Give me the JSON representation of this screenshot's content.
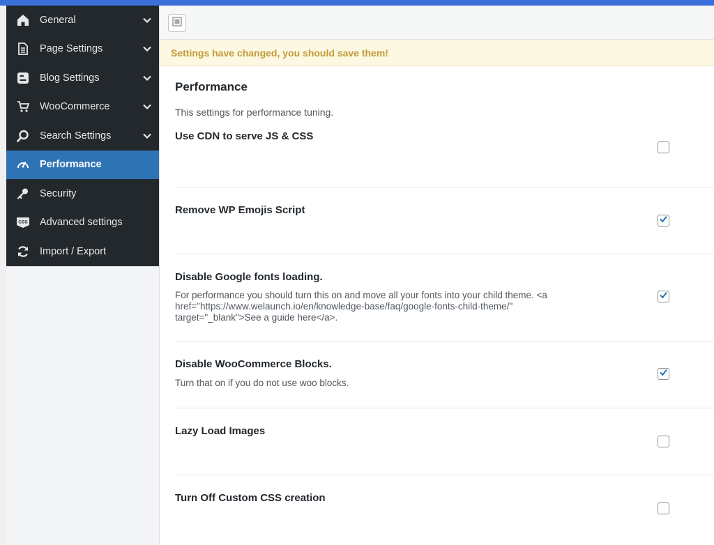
{
  "sidebar": {
    "items": [
      {
        "label": "General",
        "icon": "home-icon",
        "has_chevron": true,
        "active": false
      },
      {
        "label": "Page Settings",
        "icon": "page-icon",
        "has_chevron": true,
        "active": false
      },
      {
        "label": "Blog Settings",
        "icon": "blogger-icon",
        "has_chevron": true,
        "active": false
      },
      {
        "label": "WooCommerce",
        "icon": "cart-icon",
        "has_chevron": true,
        "active": false
      },
      {
        "label": "Search Settings",
        "icon": "search-icon",
        "has_chevron": true,
        "active": false
      },
      {
        "label": "Performance",
        "icon": "dashboard-gauge-icon",
        "has_chevron": false,
        "active": true
      },
      {
        "label": "Security",
        "icon": "key-icon",
        "has_chevron": false,
        "active": false
      },
      {
        "label": "Advanced settings",
        "icon": "css-icon",
        "has_chevron": false,
        "active": false
      },
      {
        "label": "Import / Export",
        "icon": "refresh-icon",
        "has_chevron": false,
        "active": false
      }
    ]
  },
  "notice": {
    "text": "Settings have changed, you should save them!"
  },
  "section": {
    "title": "Performance",
    "description": "This settings for performance tuning."
  },
  "settings": [
    {
      "title": "Use CDN to serve JS & CSS",
      "description": "",
      "checked": false
    },
    {
      "title": "Remove WP Emojis Script",
      "description": "",
      "checked": true
    },
    {
      "title": "Disable Google fonts loading.",
      "description": "For performance you should turn this on and move all your fonts into your child theme. <a href=\"https://www.welaunch.io/en/knowledge-base/faq/google-fonts-child-theme/\" target=\"_blank\">See a guide here</a>.",
      "checked": true
    },
    {
      "title": "Disable WooCommerce Blocks.",
      "description": "Turn that on if you do not use woo blocks.",
      "checked": true
    },
    {
      "title": "Lazy Load Images",
      "description": "",
      "checked": false
    },
    {
      "title": "Turn Off Custom CSS creation",
      "description": "",
      "checked": false
    }
  ],
  "colors": {
    "sidebar_bg": "#23282d",
    "active_bg": "#2e74b5",
    "notice_bg": "#fcf8e1",
    "notice_text": "#c29a3a",
    "checkbox_check": "#2271b1"
  }
}
